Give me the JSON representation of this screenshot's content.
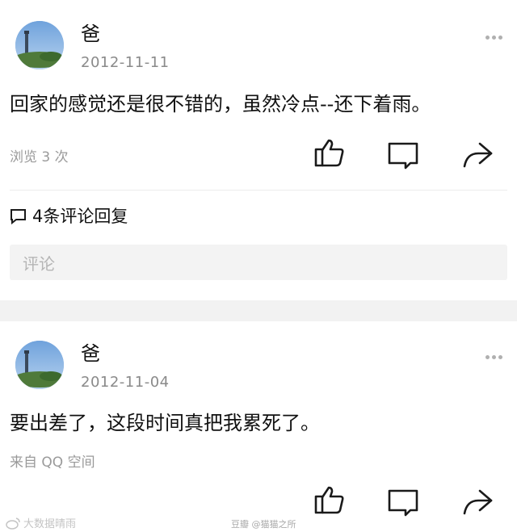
{
  "posts": [
    {
      "author": "爸",
      "date": "2012-11-11",
      "content": "回家的感觉还是很不错的，虽然冷点--还下着雨。",
      "meta": "浏览 3 次",
      "comments_label": "4条评论回复",
      "comment_placeholder": "评论"
    },
    {
      "author": "爸",
      "date": "2012-11-04",
      "content": "要出差了，这段时间真把我累死了。",
      "meta": "来自 QQ 空间"
    }
  ],
  "icons": {
    "more": "more-dots-icon",
    "like": "thumbs-up-icon",
    "comment": "comment-bubble-icon",
    "share": "share-arrow-icon"
  },
  "watermarks": {
    "left": "大数据晴雨",
    "center_prefix": "豆瓣",
    "center": "@猫猫之所"
  },
  "colors": {
    "text": "#111111",
    "muted": "#8a8a8a",
    "gap": "#f2f2f2",
    "input_bg": "#f3f3f3"
  }
}
